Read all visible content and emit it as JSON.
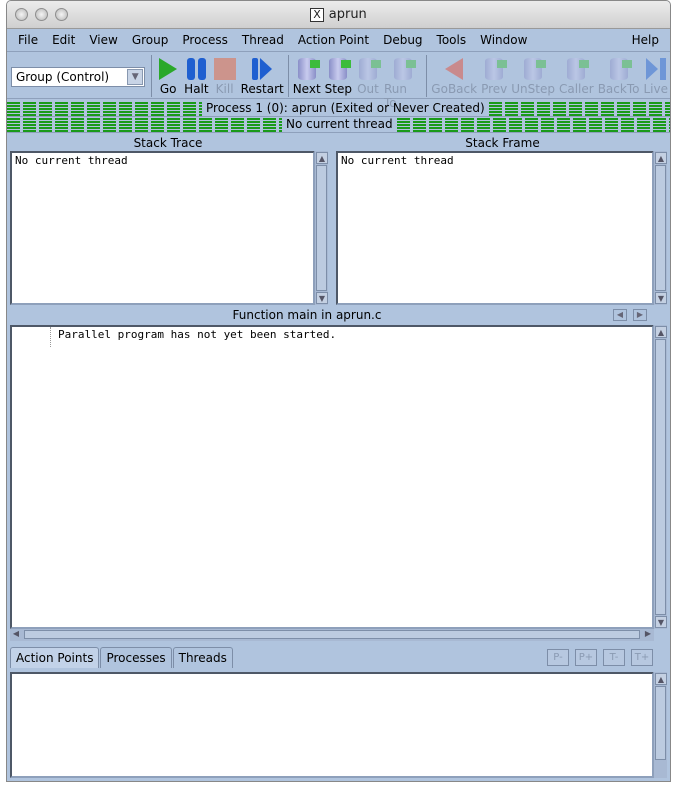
{
  "window": {
    "title": "aprun",
    "title_icon": "X"
  },
  "menu": [
    "File",
    "Edit",
    "View",
    "Group",
    "Process",
    "Thread",
    "Action Point",
    "Debug",
    "Tools",
    "Window"
  ],
  "menu_help": "Help",
  "group_select": {
    "value": "Group (Control)"
  },
  "toolbar": [
    {
      "label": "Go",
      "icon": "play-icon",
      "enabled": true
    },
    {
      "label": "Halt",
      "icon": "pause-icon",
      "enabled": true
    },
    {
      "label": "Kill",
      "icon": "stop-icon",
      "enabled": false
    },
    {
      "label": "Restart",
      "icon": "restart-icon",
      "enabled": true
    },
    {
      "label": "Next",
      "icon": "next-icon",
      "enabled": true
    },
    {
      "label": "Step",
      "icon": "step-icon",
      "enabled": true
    },
    {
      "label": "Out",
      "icon": "out-icon",
      "enabled": false
    },
    {
      "label": "Run To",
      "icon": "run-to-icon",
      "enabled": false
    },
    {
      "label": "GoBack",
      "icon": "goback-icon",
      "enabled": false
    },
    {
      "label": "Prev",
      "icon": "prev-icon",
      "enabled": false
    },
    {
      "label": "UnStep",
      "icon": "unstep-icon",
      "enabled": false
    },
    {
      "label": "Caller",
      "icon": "caller-icon",
      "enabled": false
    },
    {
      "label": "BackTo",
      "icon": "backto-icon",
      "enabled": false
    },
    {
      "label": "Live",
      "icon": "live-icon",
      "enabled": false
    }
  ],
  "status": {
    "process": "Process 1 (0): aprun (Exited or Never Created)",
    "thread": "No current thread",
    "bar_color": "#1a9a1a"
  },
  "stack_trace": {
    "header": "Stack Trace",
    "content": "No current thread"
  },
  "stack_frame": {
    "header": "Stack Frame",
    "content": "No current thread"
  },
  "source": {
    "header": "Function main in aprun.c",
    "content": "Parallel program has not yet been started."
  },
  "bottom_tabs": [
    "Action Points",
    "Processes",
    "Threads"
  ],
  "bottom_buttons": [
    "P-",
    "P+",
    "T-",
    "T+"
  ],
  "colors": {
    "background": "#b0c4de"
  }
}
